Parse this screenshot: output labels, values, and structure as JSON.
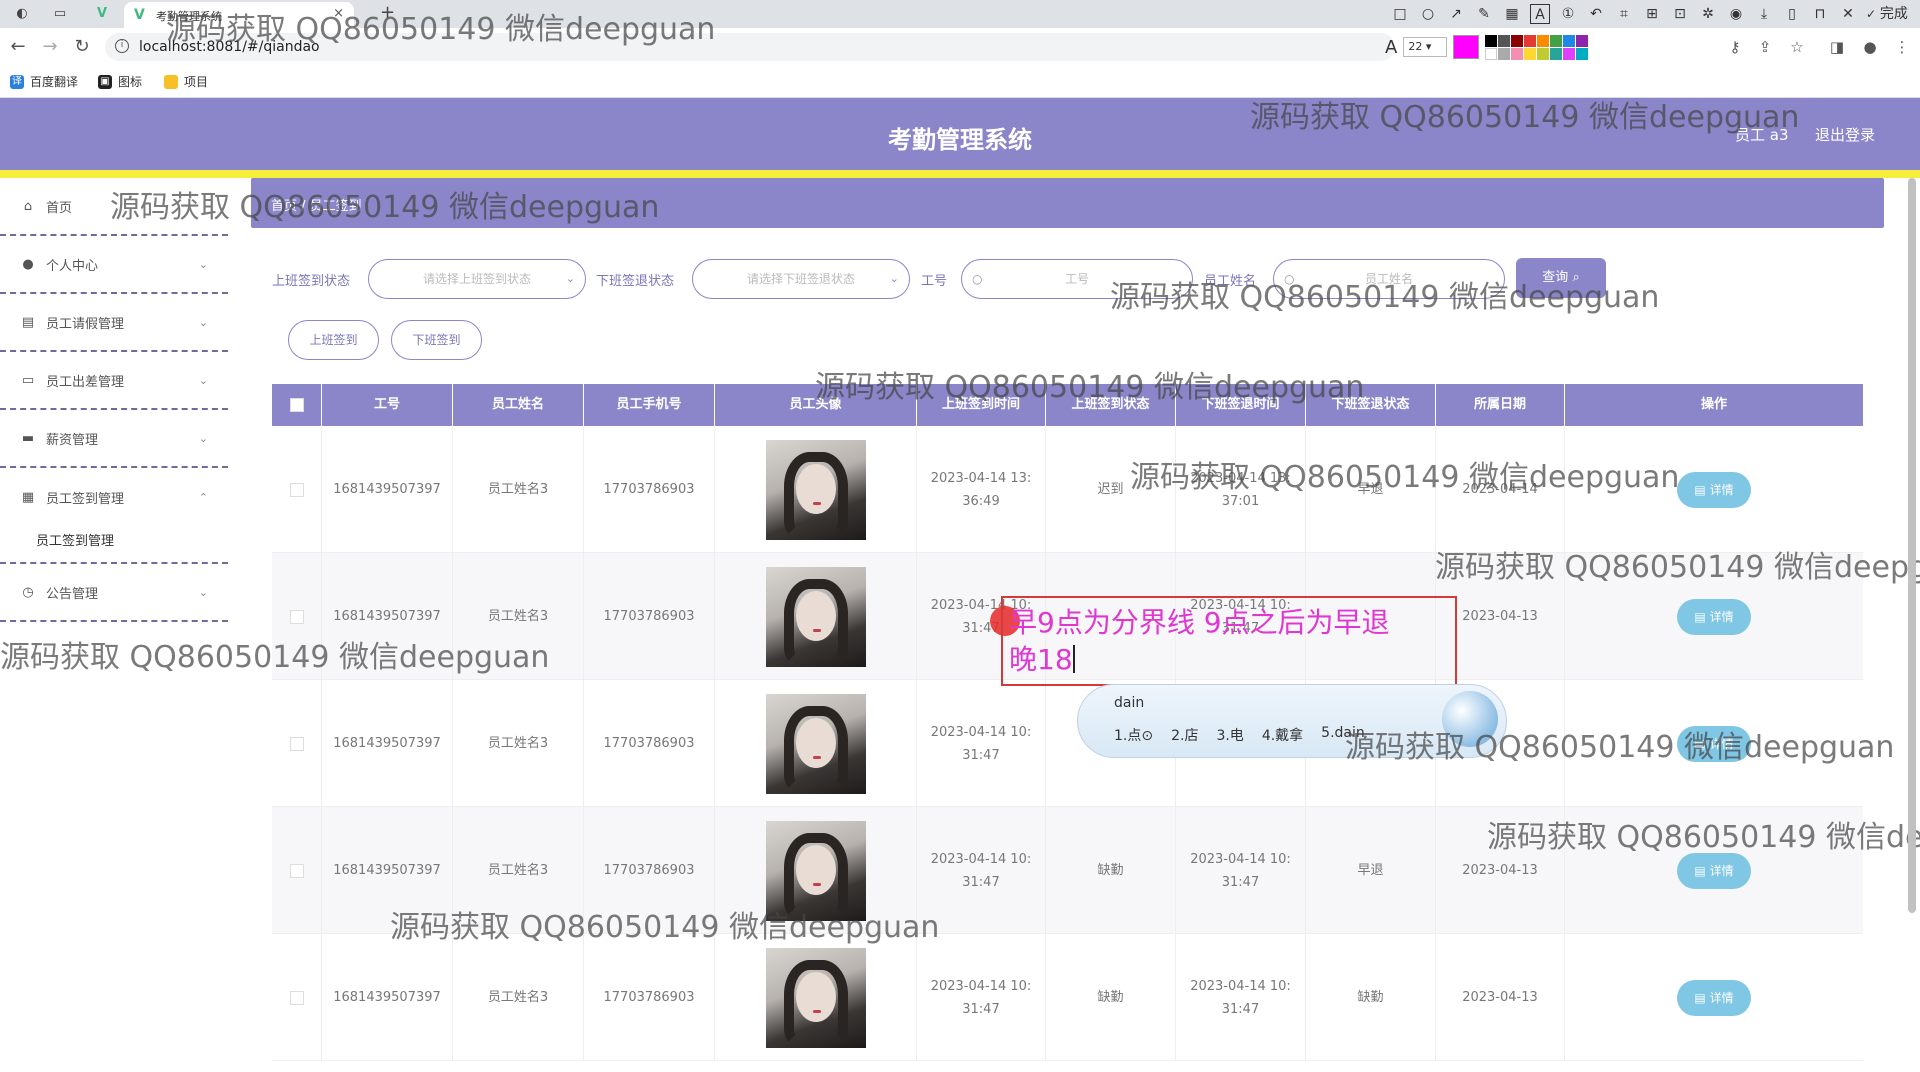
{
  "browser": {
    "tab_title": "考勤管理系统",
    "url": "localhost:8081/#/qiandao",
    "bookmarks": [
      "百度翻译",
      "图标",
      "项目"
    ],
    "draw_size": "22",
    "done_label": "完成",
    "brand_color": "#ff00ff"
  },
  "header": {
    "title": "考勤管理系统",
    "user": "员工 a3",
    "logout": "退出登录",
    "bg_color": "#8a86c9",
    "accent_color": "#f5ef3b"
  },
  "sidebar": {
    "items": [
      {
        "label": "首页",
        "icon": "home-icon"
      },
      {
        "label": "个人中心",
        "icon": "user-icon"
      },
      {
        "label": "员工请假管理",
        "icon": "chart-icon"
      },
      {
        "label": "员工出差管理",
        "icon": "chat-icon"
      },
      {
        "label": "薪资管理",
        "icon": "monitor-icon"
      },
      {
        "label": "员工签到管理",
        "icon": "grid-icon"
      },
      {
        "label": "公告管理",
        "icon": "clock-icon"
      }
    ],
    "active_sub": "员工签到管理"
  },
  "breadcrumb": {
    "home": "首页",
    "current": "员工签到"
  },
  "filters": {
    "checkin_label": "上班签到状态",
    "checkin_placeholder": "请选择上班签到状态",
    "checkout_label": "下班签退状态",
    "checkout_placeholder": "请选择下班签退状态",
    "id_label": "工号",
    "id_placeholder": "工号",
    "name_label": "员工姓名",
    "name_placeholder": "员工姓名",
    "query": "查询"
  },
  "actions": {
    "checkin": "上班签到",
    "checkout": "下班签到"
  },
  "table": {
    "headers": [
      "工号",
      "员工姓名",
      "员工手机号",
      "员工头像",
      "上班签到时间",
      "上班签到状态",
      "下班签退时间",
      "下班签退状态",
      "所属日期",
      "操作"
    ],
    "detail_label": "详情",
    "rows": [
      {
        "id": "1681439507397",
        "name": "员工姓名3",
        "phone": "17703786903",
        "in_time": "2023-04-14 13:\n36:49",
        "in_status": "迟到",
        "out_time": "2023-04-14 13:\n37:01",
        "out_status": "早退",
        "date": "2023-04-14"
      },
      {
        "id": "1681439507397",
        "name": "员工姓名3",
        "phone": "17703786903",
        "in_time": "2023-04-14 10:\n31:47",
        "in_status": "",
        "out_time": "2023-04-14 10:\n31:47",
        "out_status": "",
        "date": "2023-04-13"
      },
      {
        "id": "1681439507397",
        "name": "员工姓名3",
        "phone": "17703786903",
        "in_time": "2023-04-14 10:\n31:47",
        "in_status": "",
        "out_time": "",
        "out_status": "",
        "date": ""
      },
      {
        "id": "1681439507397",
        "name": "员工姓名3",
        "phone": "17703786903",
        "in_time": "2023-04-14 10:\n31:47",
        "in_status": "缺勤",
        "out_time": "2023-04-14 10:\n31:47",
        "out_status": "早退",
        "date": "2023-04-13"
      },
      {
        "id": "1681439507397",
        "name": "员工姓名3",
        "phone": "17703786903",
        "in_time": "2023-04-14 10:\n31:47",
        "in_status": "缺勤",
        "out_time": "2023-04-14 10:\n31:47",
        "out_status": "缺勤",
        "date": "2023-04-13"
      }
    ]
  },
  "overlays": {
    "watermark": "源码获取 QQ86050149 微信deepguan",
    "annotation_line1": "早9点为分界线 9点之后为早退",
    "annotation_line2": "晚18",
    "ime_composition": "dain",
    "ime_candidates": [
      "1.点⊙",
      "2.店",
      "3.电",
      "4.戴拿",
      "5.dain"
    ]
  }
}
